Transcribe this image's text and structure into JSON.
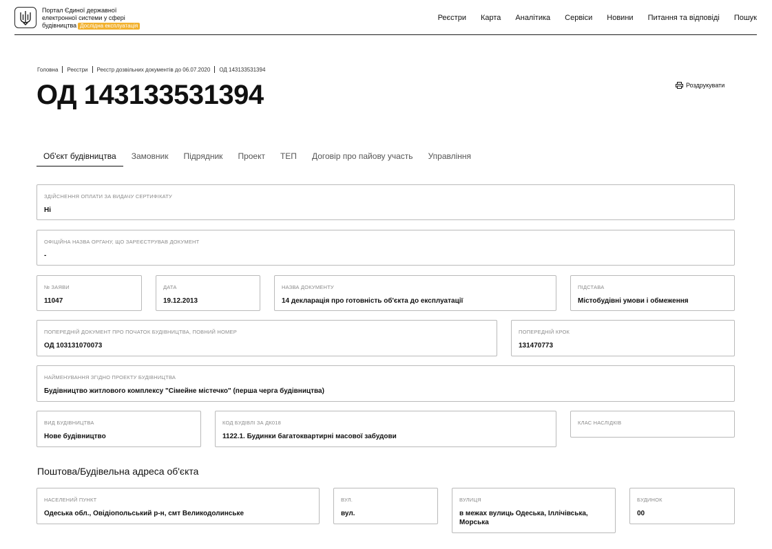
{
  "header": {
    "logo_line1": "Портал Єдиної державної",
    "logo_line2": "електронної системи у сфері",
    "logo_line3": "будівництва",
    "badge": "Дослідна експлуатація",
    "nav": [
      "Реєстри",
      "Карта",
      "Аналітика",
      "Сервіси",
      "Новини",
      "Питання та відповіді",
      "Пошук"
    ]
  },
  "breadcrumb": [
    "Головна",
    "Реєстри",
    "Реєстр дозвільних документів до 06.07.2020",
    "ОД 143133531394"
  ],
  "page_title": "ОД 143133531394",
  "print_label": "Роздрукувати",
  "tabs": [
    "Об'єкт будівництва",
    "Замовник",
    "Підрядник",
    "Проект",
    "ТЕП",
    "Договір про пайову участь",
    "Управління"
  ],
  "fields": {
    "payment": {
      "label": "Здійснення оплати за видачу сертифікату",
      "value": "Ні"
    },
    "authority": {
      "label": "Офіційна назва органу, що зареєстрував документ",
      "value": "-"
    },
    "app_no": {
      "label": "№ заяви",
      "value": "11047"
    },
    "date": {
      "label": "Дата",
      "value": "19.12.2013"
    },
    "doc_name": {
      "label": "Назва документу",
      "value": "14 декларація про готовність об'єкта до експлуатації"
    },
    "basis": {
      "label": "Підстава",
      "value": "Містобудівні умови і обмеження"
    },
    "prev_doc": {
      "label": "Попередній документ про початок будівництва, повний номер",
      "value": "ОД 103131070073"
    },
    "prev_step": {
      "label": "Попередній крок",
      "value": "131470773"
    },
    "project_name": {
      "label": "Найменування згідно проекту будівництва",
      "value": "Будівництво житлового комплексу \"Сімейне містечко\" (перша черга будівництва)"
    },
    "build_type": {
      "label": "Вид будівництва",
      "value": "Нове будівництво"
    },
    "building_code": {
      "label": "Код будівлі за ДК018",
      "value": "1122.1. Будинки багатоквартирні масової забудови"
    },
    "consequence_class": {
      "label": "Клас наслідків",
      "value": ""
    }
  },
  "address": {
    "title": "Поштова/Будівельна адреса об'єкта",
    "settlement": {
      "label": "Населений пункт",
      "value": "Одеська обл., Овідіопольський р-н, смт Великодолинське"
    },
    "street_type": {
      "label": "Вул.",
      "value": "вул."
    },
    "street": {
      "label": "Вулиця",
      "value": "в межах вулиць Одеська, Іллічівська, Морська"
    },
    "house": {
      "label": "Будинок",
      "value": "00"
    }
  }
}
